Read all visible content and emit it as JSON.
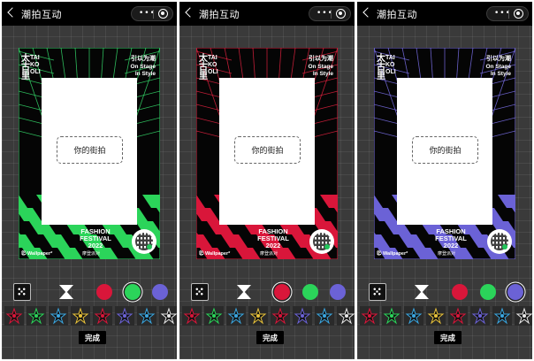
{
  "screens": [
    {
      "nav": {
        "title": "潮拍互动",
        "more_label": "•••"
      },
      "poster": {
        "brand_cn": "太古里",
        "brand_en": "TAIKOOLI",
        "slogan_cn": "引以为潮",
        "slogan_en_1": "On Stage",
        "slogan_en_2": "In Style",
        "photo_label": "你的街拍",
        "fest_1": "FASHION",
        "fest_2": "FESTIVAL",
        "fest_3": "2022",
        "wallpaper": "㊣ Wallpaper*",
        "sub_cn": "摩登派对",
        "theme_color": "#2bd45a",
        "grid_color": "#35d96a"
      },
      "selected_swatch": "green",
      "done_label": "完成"
    },
    {
      "nav": {
        "title": "潮拍互动",
        "more_label": "•••"
      },
      "poster": {
        "brand_cn": "太古里",
        "brand_en": "TAIKOOLI",
        "slogan_cn": "引以为潮",
        "slogan_en_1": "On Stage",
        "slogan_en_2": "In Style",
        "photo_label": "你的街拍",
        "fest_1": "FASHION",
        "fest_2": "FESTIVAL",
        "fest_3": "2022",
        "wallpaper": "㊣ Wallpaper*",
        "sub_cn": "摩登派对",
        "theme_color": "#d9163a",
        "grid_color": "#e0223f"
      },
      "selected_swatch": "red",
      "done_label": "完成"
    },
    {
      "nav": {
        "title": "潮拍互动",
        "more_label": "•••"
      },
      "poster": {
        "brand_cn": "太古里",
        "brand_en": "TAIKOOLI",
        "slogan_cn": "引以为潮",
        "slogan_en_1": "On Stage",
        "slogan_en_2": "In Style",
        "photo_label": "你的街拍",
        "fest_1": "FASHION",
        "fest_2": "FESTIVAL",
        "fest_3": "2022",
        "wallpaper": "㊣ Wallpaper*",
        "sub_cn": "摩登派对",
        "theme_color": "#6b62d6",
        "grid_color": "#7a6fe8"
      },
      "selected_swatch": "purple",
      "done_label": "完成"
    }
  ],
  "swatches": [
    {
      "name": "red",
      "color": "#d9163a"
    },
    {
      "name": "green",
      "color": "#2bd45a"
    },
    {
      "name": "purple",
      "color": "#6b62d6"
    }
  ],
  "sticker_colors": [
    "#d9163a",
    "#2bd45a",
    "#3aa6e0",
    "#e8c23a",
    "#d9163a",
    "#6b62d6",
    "#3aa6e0",
    "#e8e8e8"
  ],
  "icons": {
    "back": "chevron-left-icon",
    "more": "more-dots-icon",
    "target": "target-icon",
    "frame_tool": "frame-tool-icon",
    "hourglass_tool": "hourglass-tool-icon",
    "sticker": "star-sticker-icon"
  }
}
